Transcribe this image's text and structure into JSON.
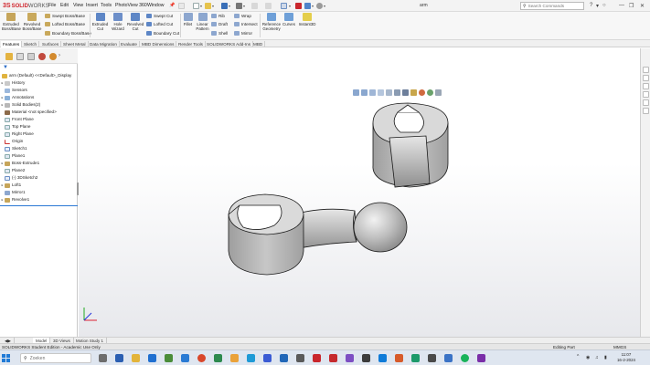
{
  "app": {
    "logo_ds": "3S",
    "logo_solid": "SOLID",
    "logo_works": "WORKS",
    "document_title": "arm"
  },
  "menu": [
    "File",
    "Edit",
    "View",
    "Insert",
    "Tools",
    "PhotoView 360",
    "Window"
  ],
  "search": {
    "placeholder": "Search Commands"
  },
  "ribbon": {
    "extruded_boss": "Extruded Boss/Base",
    "revolved_boss": "Revolved Boss/Base",
    "swept_boss": "Swept Boss/Base",
    "lofted_boss": "Lofted Boss/Base",
    "boundary_boss": "Boundary Boss/Base",
    "extruded_cut": "Extruded Cut",
    "hole_wizard": "Hole Wizard",
    "revolved_cut": "Revolved Cut",
    "swept_cut": "Swept Cut",
    "lofted_cut": "Lofted Cut",
    "boundary_cut": "Boundary Cut",
    "fillet": "Fillet",
    "linear_pattern": "Linear Pattern",
    "rib": "Rib",
    "draft": "Draft",
    "shell": "Shell",
    "wrap": "Wrap",
    "intersect": "Intersect",
    "mirror": "Mirror",
    "reference_geometry": "Reference Geometry",
    "curves": "Curves",
    "instant3d": "Instant3D"
  },
  "tabs": [
    "Features",
    "Sketch",
    "Surfaces",
    "Sheet Metal",
    "Data Migration",
    "Evaluate",
    "MBD Dimensions",
    "Render Tools",
    "SOLIDWORKS Add-Ins",
    "MBD"
  ],
  "tree": {
    "root": "arm (Default) <<Default>_Display",
    "items": [
      "History",
      "Sensors",
      "Annotations",
      "Solid Bodies(2)",
      "Material <not specified>",
      "Front Plane",
      "Top Plane",
      "Right Plane",
      "Origin",
      "Sketch1",
      "Plane1",
      "Boss-Extrude1",
      "Plane2",
      "(-) 3DSketch2",
      "Loft1",
      "Mirror1",
      "Revolve1"
    ]
  },
  "model_tabs": [
    "Model",
    "3D Views",
    "Motion Study 1"
  ],
  "status": {
    "left": "SOLIDWORKS Student Edition - Academic Use Only",
    "mode": "Editing Part",
    "units": "MMGS"
  },
  "taskbar": {
    "search_placeholder": "Zoeken",
    "time": "11:07",
    "date": "16-2-2024"
  }
}
